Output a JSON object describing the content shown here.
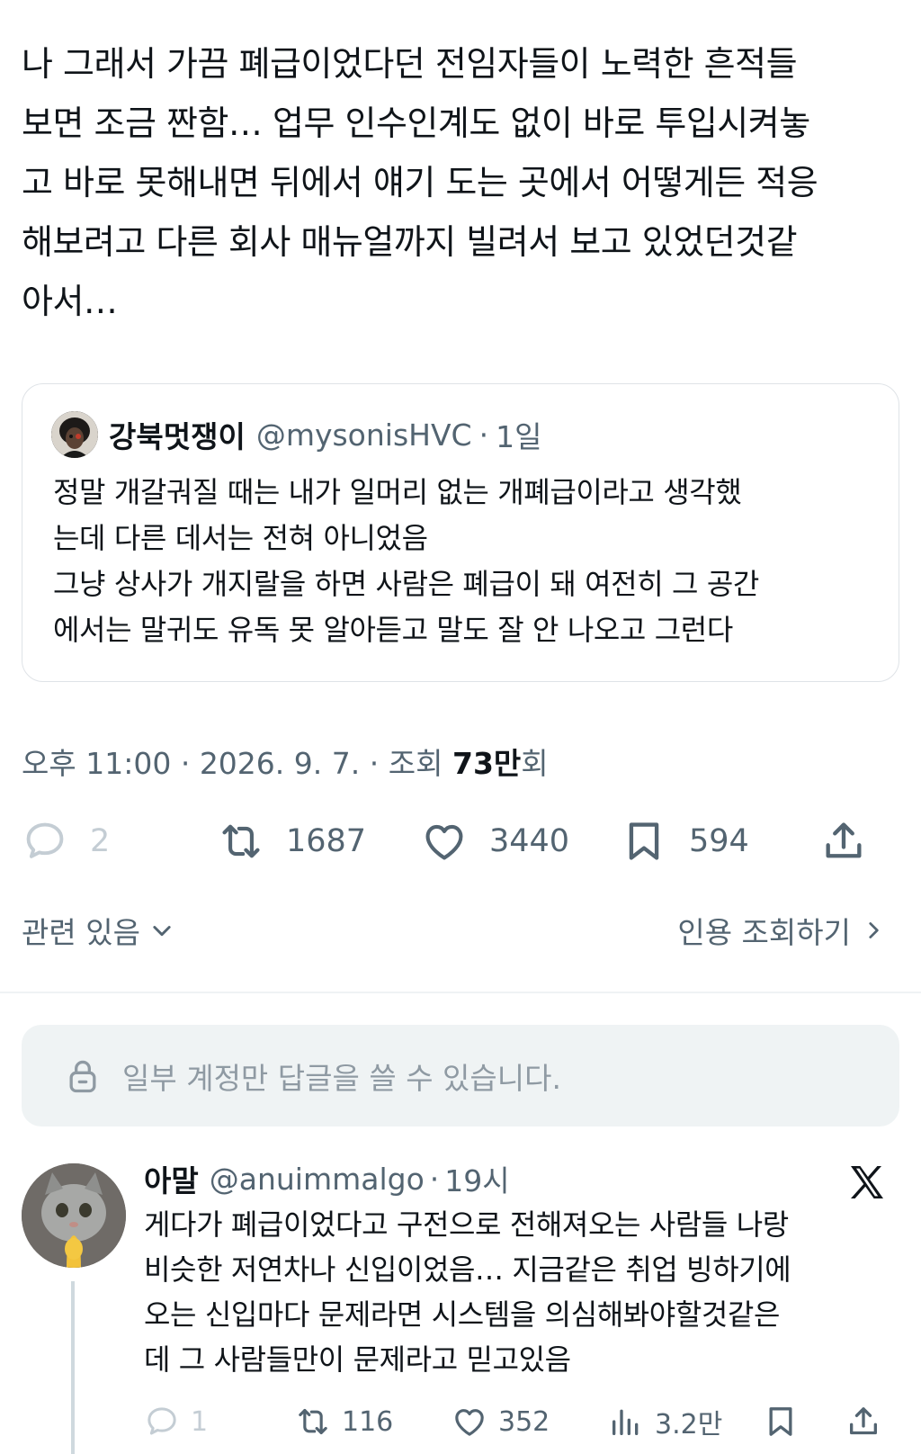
{
  "tweet": {
    "lines": [
      "나 그래서 가끔 폐급이었다던 전임자들이 노력한 흔적들",
      "보면 조금 짠함… 업무 인수인계도 없이 바로 투입시켜놓",
      "고 바로 못해내면 뒤에서 얘기 도는 곳에서 어떻게든 적응",
      "해보려고 다른 회사 매뉴얼까지 빌려서 보고 있었던것같",
      "아서…"
    ],
    "meta": {
      "time": "오후 11:00",
      "sep1": "·",
      "date": "2026. 9. 7.",
      "sep2": "·",
      "views_label": "조회",
      "views_value": "73만",
      "views_suffix": "회"
    },
    "actions": {
      "replies": "2",
      "retweets": "1687",
      "likes": "3440",
      "bookmarks": "594"
    }
  },
  "quoted": {
    "name": "강북멋쟁이",
    "handle": "@mysonisHVC",
    "dot": "·",
    "time": "1일",
    "lines": [
      "정말 개갈궈질 때는 내가 일머리 없는 개폐급이라고 생각했",
      "는데 다른 데서는 전혀 아니었음",
      "그냥 상사가 개지랄을 하면 사람은 폐급이 돼 여전히 그 공간",
      "에서는 말귀도 유독 못 알아듣고 말도 잘 안 나오고 그런다"
    ]
  },
  "links": {
    "related": "관련 있음",
    "quotes": "인용 조회하기"
  },
  "reply_restriction": "일부 계정만 답글을 쓸 수 있습니다.",
  "reply": {
    "name": "아말",
    "handle": "@anuimmalgo",
    "dot": "·",
    "time": "19시",
    "lines": [
      "게다가 폐급이었다고 구전으로 전해져오는 사람들 나랑",
      "비슷한 저연차나 신입이었음… 지금같은 취업 빙하기에",
      "오는 신입마다 문제라면 시스템을 의심해봐야할것같은",
      "데 그 사람들만이 문제라고 믿고있음"
    ],
    "actions": {
      "replies": "1",
      "retweets": "116",
      "likes": "352",
      "views": "3.2만"
    }
  },
  "icons": {
    "reply": "speech-bubble-icon",
    "retweet": "retweet-icon",
    "like": "heart-icon",
    "bookmark": "bookmark-icon",
    "share": "share-icon",
    "views": "bar-chart-icon",
    "lock": "lock-icon",
    "x_logo": "x-logo-icon"
  }
}
